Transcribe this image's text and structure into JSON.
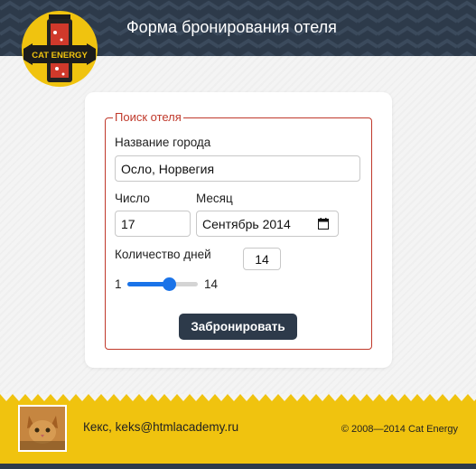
{
  "header": {
    "title": "Форма бронирования отеля",
    "logo_text": "CAT ENERGY",
    "bg_color": "#2d3a4a"
  },
  "form": {
    "legend": "Поиск отеля",
    "city_label": "Название города",
    "city_value": "Осло, Норвегия",
    "day_label": "Число",
    "day_value": "17",
    "month_label": "Месяц",
    "month_value": "Сентябрь 2014",
    "days_label": "Количество дней",
    "days_value": "14",
    "range_min": "1",
    "range_max": "14",
    "range_level": 0.6,
    "submit_label": "Забронировать",
    "accent_color": "#c0392b"
  },
  "footer": {
    "contact": "Кекс, keks@htmlacademy.ru",
    "copyright": "© 2008—2014 Cat Energy",
    "bg_color": "#f0c30f"
  }
}
